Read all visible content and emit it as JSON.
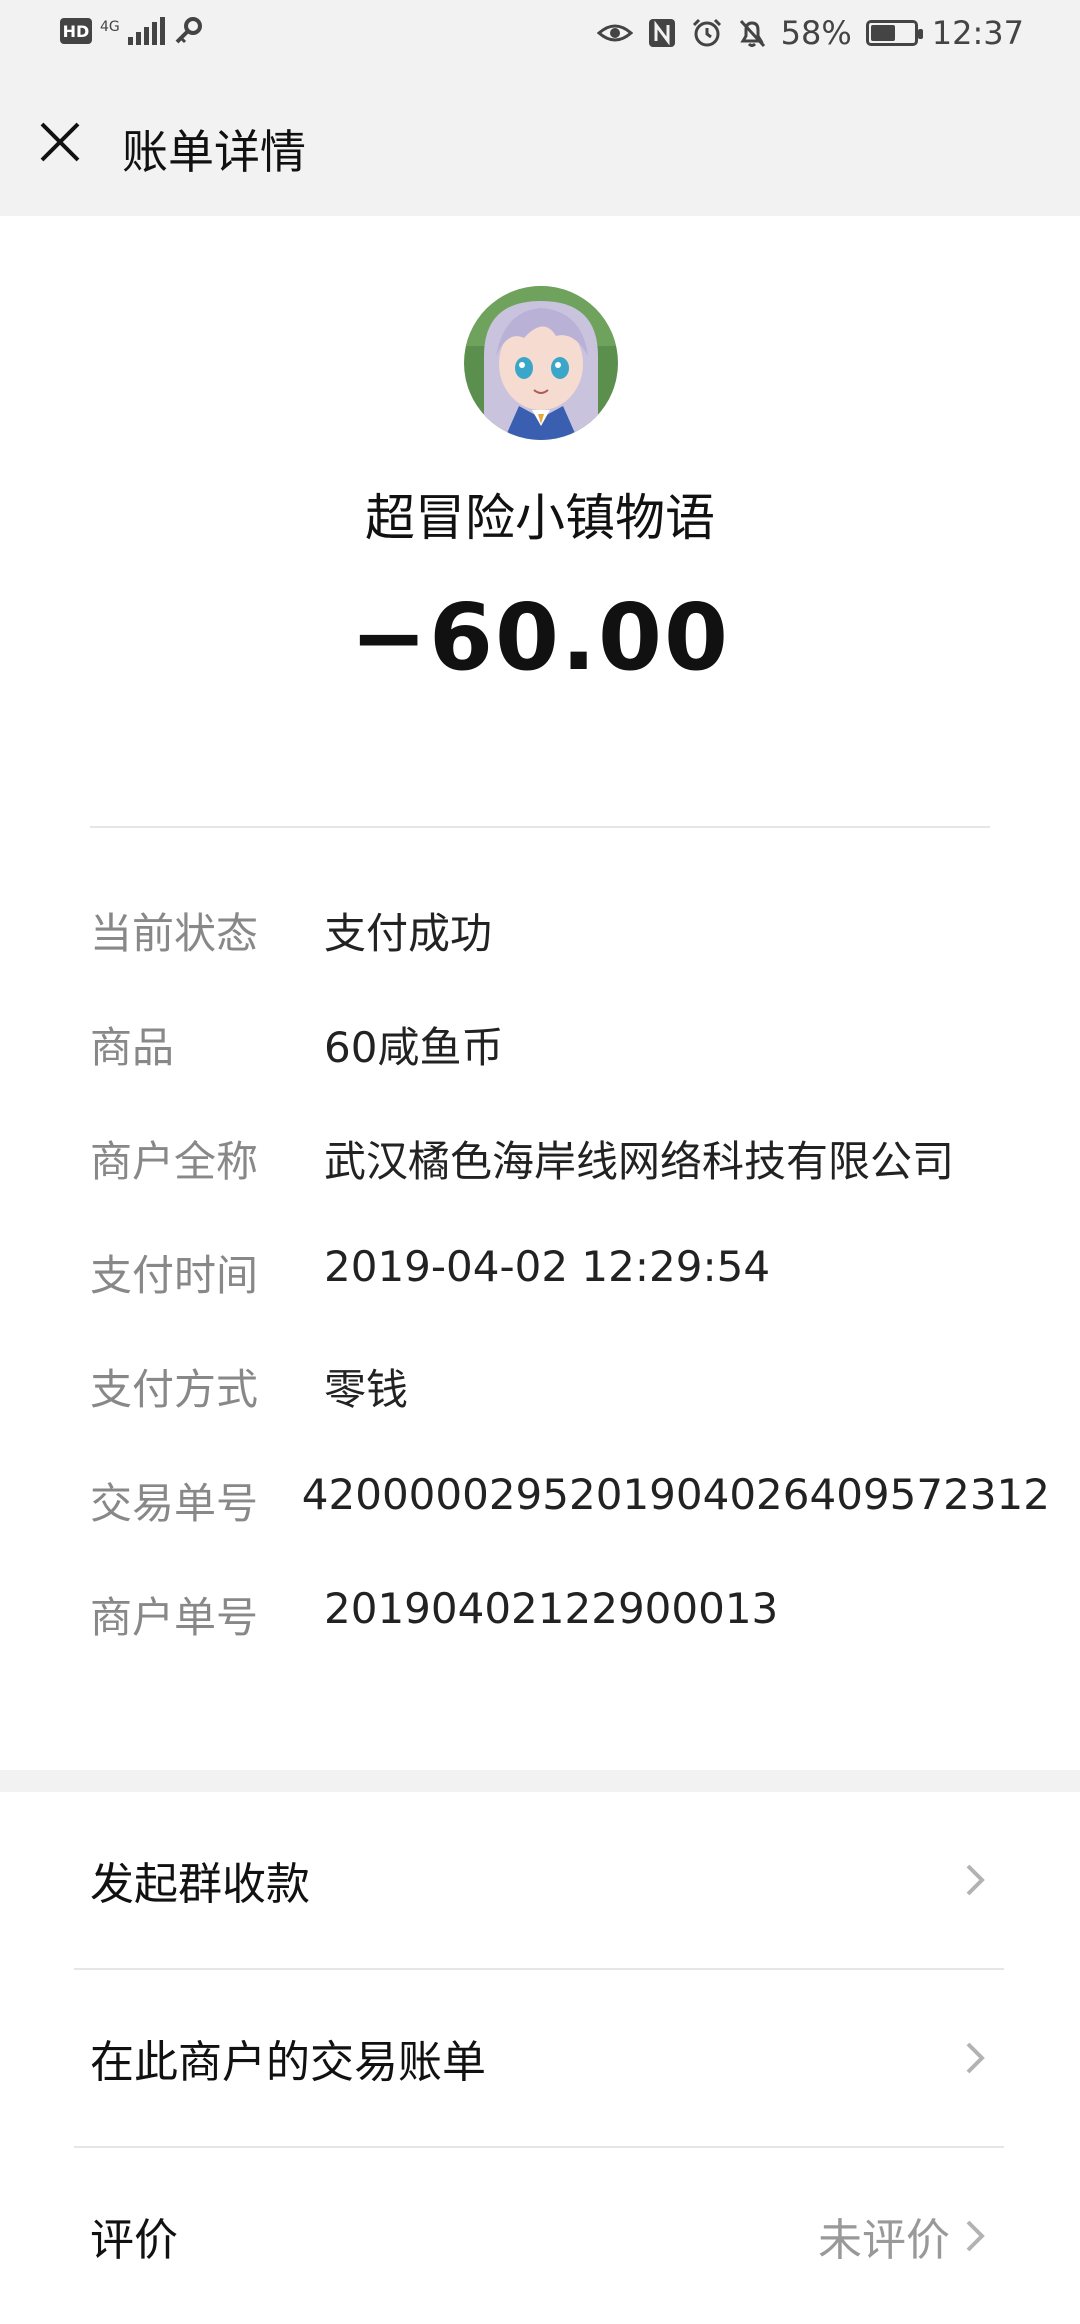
{
  "status_bar": {
    "hd": "HD",
    "network": "4G",
    "battery": "58%",
    "battery_level": 0.58,
    "time": "12:37",
    "icons": [
      "eye-icon",
      "nfc-icon",
      "alarm-icon",
      "bell-off-icon"
    ]
  },
  "header": {
    "title": "账单详情",
    "close_icon": "close-icon"
  },
  "merchant": {
    "name": "超冒险小镇物语",
    "amount": "−60.00"
  },
  "details": [
    {
      "label": "当前状态",
      "value": "支付成功"
    },
    {
      "label": "商品",
      "value": "60咸鱼币"
    },
    {
      "label": "商户全称",
      "value": "武汉橘色海岸线网络科技有限公司"
    },
    {
      "label": "支付时间",
      "value": "2019-04-02 12:29:54"
    },
    {
      "label": "支付方式",
      "value": "零钱"
    },
    {
      "label": "交易单号",
      "value": "4200000295201904026409572312"
    },
    {
      "label": "商户单号",
      "value": "20190402122900013"
    }
  ],
  "actions": [
    {
      "label": "发起群收款",
      "value": ""
    },
    {
      "label": "在此商户的交易账单",
      "value": ""
    },
    {
      "label": "评价",
      "value": "未评价"
    }
  ],
  "colors": {
    "header_bg": "#f2f2f2",
    "label_gray": "#888888",
    "value_dark": "#222222"
  }
}
